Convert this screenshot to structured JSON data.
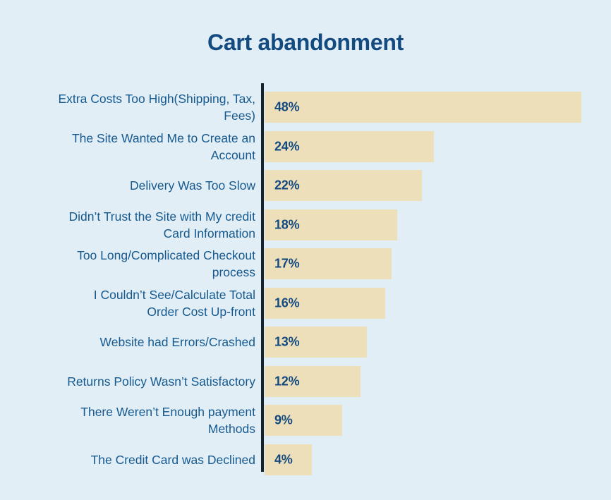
{
  "chart_data": {
    "type": "bar",
    "orientation": "horizontal",
    "title": "Cart abandonment",
    "xlabel": "",
    "ylabel": "",
    "grid": false,
    "legend": null,
    "value_suffix": "%",
    "xlim": [
      0,
      48
    ],
    "categories": [
      "Extra Costs Too High(Shipping, Tax, Fees)",
      "The Site Wanted Me to Create an Account",
      "Delivery Was Too Slow",
      "Didn’t Trust the Site with My credit Card Information",
      "Too Long/Complicated Checkout process",
      "I Couldn’t See/Calculate Total Order Cost Up-front",
      "Website had Errors/Crashed",
      "Returns Policy Wasn’t Satisfactory",
      "There Weren’t Enough payment Methods",
      "The Credit Card was Declined"
    ],
    "values": [
      48,
      24,
      22,
      18,
      17,
      16,
      13,
      12,
      9,
      4
    ],
    "value_labels": [
      "48%",
      "24%",
      "22%",
      "18%",
      "17%",
      "16%",
      "13%",
      "12%",
      "9%",
      "4%"
    ],
    "bars": [
      {
        "label": "Extra Costs Too High(Shipping, Tax,\nFees)",
        "value": 48,
        "value_label": "48%"
      },
      {
        "label": "The Site Wanted Me to Create an\nAccount",
        "value": 24,
        "value_label": "24%"
      },
      {
        "label": "Delivery Was Too Slow",
        "value": 22,
        "value_label": "22%"
      },
      {
        "label": "Didn’t Trust the Site with My credit\nCard Information",
        "value": 18,
        "value_label": "18%"
      },
      {
        "label": "Too Long/Complicated Checkout\nprocess",
        "value": 17,
        "value_label": "17%"
      },
      {
        "label": "I Couldn’t See/Calculate Total\nOrder Cost Up-front",
        "value": 16,
        "value_label": "16%"
      },
      {
        "label": "Website had Errors/Crashed",
        "value": 13,
        "value_label": "13%"
      },
      {
        "label": "Returns Policy Wasn’t Satisfactory",
        "value": 12,
        "value_label": "12%"
      },
      {
        "label": "There Weren’t Enough payment\nMethods",
        "value": 9,
        "value_label": "9%"
      },
      {
        "label": "The Credit Card was Declined",
        "value": 4,
        "value_label": "4%"
      }
    ]
  },
  "colors": {
    "background": "#e2eef6",
    "bar": "#eedfbb",
    "title": "#134a80",
    "value_text": "#134a80",
    "category_text": "#15598f",
    "axis_line": "#15232e"
  }
}
